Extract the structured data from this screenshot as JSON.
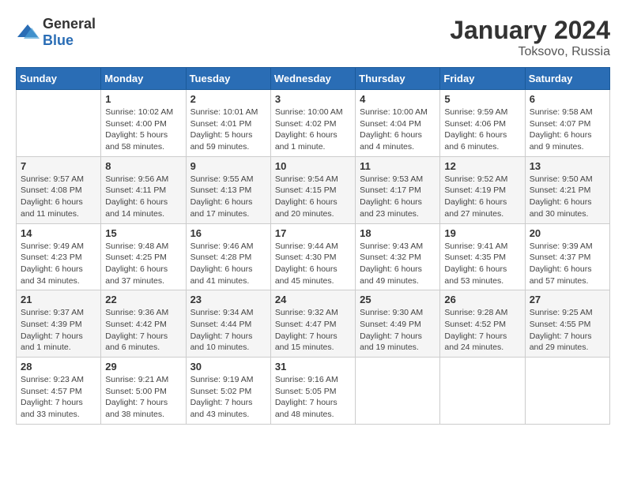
{
  "header": {
    "logo_general": "General",
    "logo_blue": "Blue",
    "month_year": "January 2024",
    "location": "Toksovo, Russia"
  },
  "calendar": {
    "weekdays": [
      "Sunday",
      "Monday",
      "Tuesday",
      "Wednesday",
      "Thursday",
      "Friday",
      "Saturday"
    ],
    "weeks": [
      [
        {
          "day": "",
          "info": ""
        },
        {
          "day": "1",
          "info": "Sunrise: 10:02 AM\nSunset: 4:00 PM\nDaylight: 5 hours\nand 58 minutes."
        },
        {
          "day": "2",
          "info": "Sunrise: 10:01 AM\nSunset: 4:01 PM\nDaylight: 5 hours\nand 59 minutes."
        },
        {
          "day": "3",
          "info": "Sunrise: 10:00 AM\nSunset: 4:02 PM\nDaylight: 6 hours\nand 1 minute."
        },
        {
          "day": "4",
          "info": "Sunrise: 10:00 AM\nSunset: 4:04 PM\nDaylight: 6 hours\nand 4 minutes."
        },
        {
          "day": "5",
          "info": "Sunrise: 9:59 AM\nSunset: 4:06 PM\nDaylight: 6 hours\nand 6 minutes."
        },
        {
          "day": "6",
          "info": "Sunrise: 9:58 AM\nSunset: 4:07 PM\nDaylight: 6 hours\nand 9 minutes."
        }
      ],
      [
        {
          "day": "7",
          "info": "Sunrise: 9:57 AM\nSunset: 4:08 PM\nDaylight: 6 hours\nand 11 minutes."
        },
        {
          "day": "8",
          "info": "Sunrise: 9:56 AM\nSunset: 4:11 PM\nDaylight: 6 hours\nand 14 minutes."
        },
        {
          "day": "9",
          "info": "Sunrise: 9:55 AM\nSunset: 4:13 PM\nDaylight: 6 hours\nand 17 minutes."
        },
        {
          "day": "10",
          "info": "Sunrise: 9:54 AM\nSunset: 4:15 PM\nDaylight: 6 hours\nand 20 minutes."
        },
        {
          "day": "11",
          "info": "Sunrise: 9:53 AM\nSunset: 4:17 PM\nDaylight: 6 hours\nand 23 minutes."
        },
        {
          "day": "12",
          "info": "Sunrise: 9:52 AM\nSunset: 4:19 PM\nDaylight: 6 hours\nand 27 minutes."
        },
        {
          "day": "13",
          "info": "Sunrise: 9:50 AM\nSunset: 4:21 PM\nDaylight: 6 hours\nand 30 minutes."
        }
      ],
      [
        {
          "day": "14",
          "info": "Sunrise: 9:49 AM\nSunset: 4:23 PM\nDaylight: 6 hours\nand 34 minutes."
        },
        {
          "day": "15",
          "info": "Sunrise: 9:48 AM\nSunset: 4:25 PM\nDaylight: 6 hours\nand 37 minutes."
        },
        {
          "day": "16",
          "info": "Sunrise: 9:46 AM\nSunset: 4:28 PM\nDaylight: 6 hours\nand 41 minutes."
        },
        {
          "day": "17",
          "info": "Sunrise: 9:44 AM\nSunset: 4:30 PM\nDaylight: 6 hours\nand 45 minutes."
        },
        {
          "day": "18",
          "info": "Sunrise: 9:43 AM\nSunset: 4:32 PM\nDaylight: 6 hours\nand 49 minutes."
        },
        {
          "day": "19",
          "info": "Sunrise: 9:41 AM\nSunset: 4:35 PM\nDaylight: 6 hours\nand 53 minutes."
        },
        {
          "day": "20",
          "info": "Sunrise: 9:39 AM\nSunset: 4:37 PM\nDaylight: 6 hours\nand 57 minutes."
        }
      ],
      [
        {
          "day": "21",
          "info": "Sunrise: 9:37 AM\nSunset: 4:39 PM\nDaylight: 7 hours\nand 1 minute."
        },
        {
          "day": "22",
          "info": "Sunrise: 9:36 AM\nSunset: 4:42 PM\nDaylight: 7 hours\nand 6 minutes."
        },
        {
          "day": "23",
          "info": "Sunrise: 9:34 AM\nSunset: 4:44 PM\nDaylight: 7 hours\nand 10 minutes."
        },
        {
          "day": "24",
          "info": "Sunrise: 9:32 AM\nSunset: 4:47 PM\nDaylight: 7 hours\nand 15 minutes."
        },
        {
          "day": "25",
          "info": "Sunrise: 9:30 AM\nSunset: 4:49 PM\nDaylight: 7 hours\nand 19 minutes."
        },
        {
          "day": "26",
          "info": "Sunrise: 9:28 AM\nSunset: 4:52 PM\nDaylight: 7 hours\nand 24 minutes."
        },
        {
          "day": "27",
          "info": "Sunrise: 9:25 AM\nSunset: 4:55 PM\nDaylight: 7 hours\nand 29 minutes."
        }
      ],
      [
        {
          "day": "28",
          "info": "Sunrise: 9:23 AM\nSunset: 4:57 PM\nDaylight: 7 hours\nand 33 minutes."
        },
        {
          "day": "29",
          "info": "Sunrise: 9:21 AM\nSunset: 5:00 PM\nDaylight: 7 hours\nand 38 minutes."
        },
        {
          "day": "30",
          "info": "Sunrise: 9:19 AM\nSunset: 5:02 PM\nDaylight: 7 hours\nand 43 minutes."
        },
        {
          "day": "31",
          "info": "Sunrise: 9:16 AM\nSunset: 5:05 PM\nDaylight: 7 hours\nand 48 minutes."
        },
        {
          "day": "",
          "info": ""
        },
        {
          "day": "",
          "info": ""
        },
        {
          "day": "",
          "info": ""
        }
      ]
    ]
  }
}
